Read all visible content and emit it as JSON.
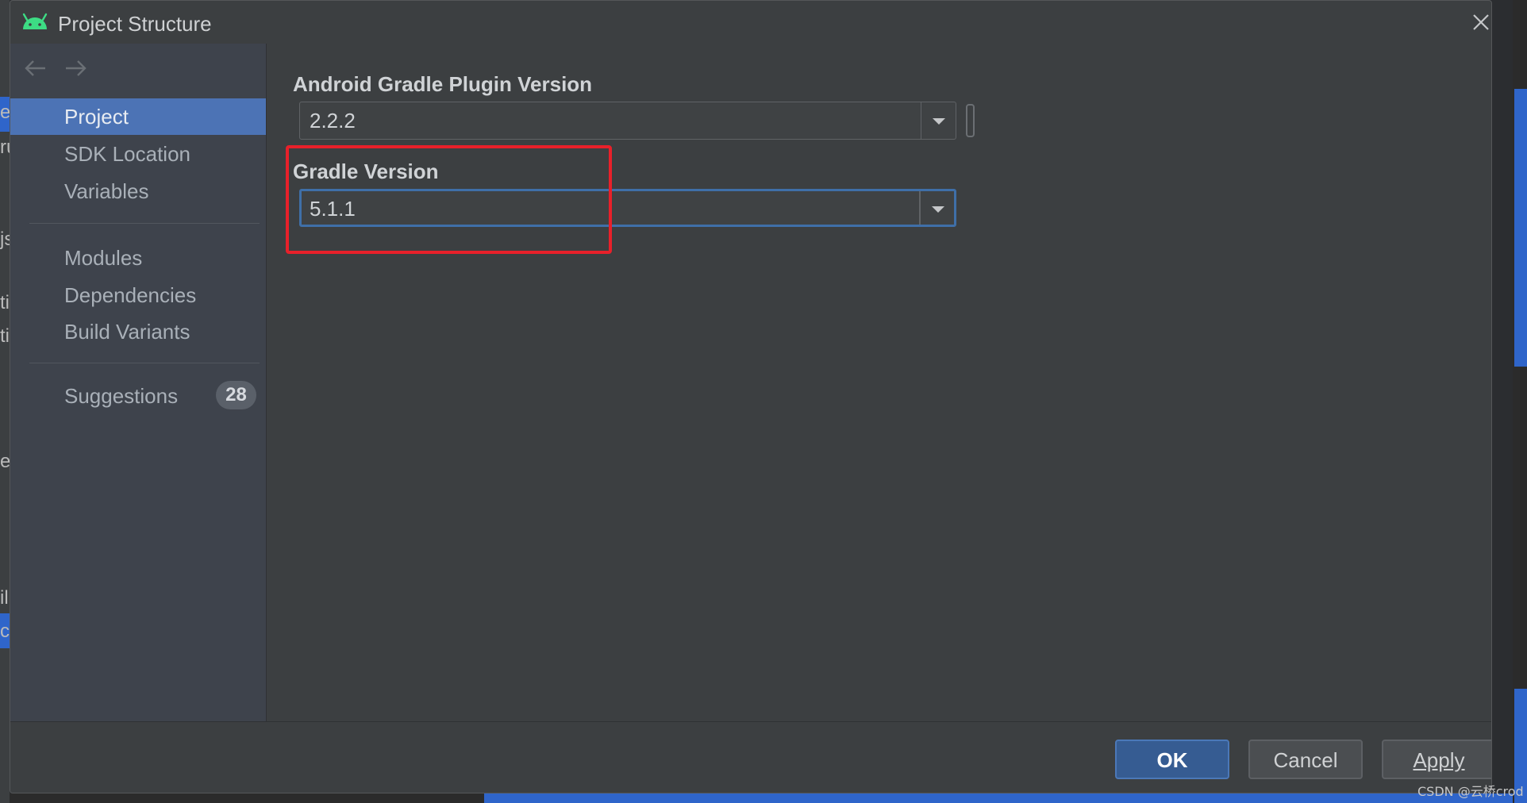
{
  "dialog": {
    "title": "Project Structure",
    "icon": "android-icon"
  },
  "sidebar": {
    "items": [
      {
        "label": "Project",
        "selected": true
      },
      {
        "label": "SDK Location"
      },
      {
        "label": "Variables"
      },
      {
        "label": "Modules"
      },
      {
        "label": "Dependencies"
      },
      {
        "label": "Build Variants"
      },
      {
        "label": "Suggestions",
        "badge": "28"
      }
    ]
  },
  "content": {
    "agp_label": "Android Gradle Plugin Version",
    "agp_value": "2.2.2",
    "gradle_label": "Gradle Version",
    "gradle_value": "5.1.1"
  },
  "footer": {
    "ok": "OK",
    "cancel": "Cancel",
    "apply": "Apply"
  },
  "background": {
    "fragments": [
      "e",
      "ru",
      "js",
      "ti",
      "ti",
      "es",
      "il",
      "co"
    ]
  },
  "watermark": "CSDN @云桥crod",
  "colors": {
    "accent": "#4c73b5",
    "highlight": "#e8202a",
    "android": "#3ddc84"
  }
}
